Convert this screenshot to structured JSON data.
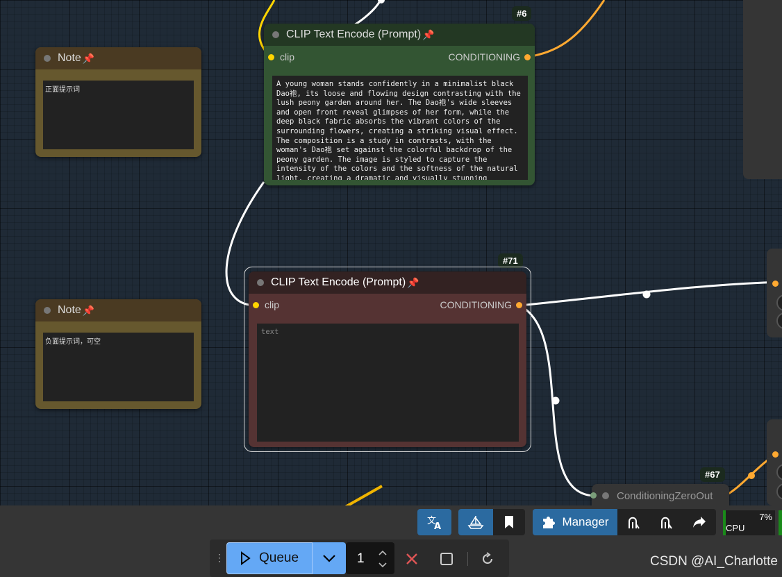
{
  "nodes": {
    "note1": {
      "title": "Note",
      "text": "正面提示词"
    },
    "note2": {
      "title": "Note",
      "text": "负面提示词，可空"
    },
    "clip6": {
      "badge": "#6",
      "title": "CLIP Text Encode (Prompt)",
      "input": "clip",
      "output": "CONDITIONING",
      "text": "A young woman stands confidently in a minimalist black Dao袍, its loose and flowing design contrasting with the lush peony garden around her. The Dao袍's wide sleeves and open front reveal glimpses of her form, while the deep black fabric absorbs the vibrant colors of the surrounding flowers, creating a striking visual effect. The composition is a study in contrasts, with the woman's Dao袍 set against the colorful backdrop of the peony garden. The image is styled to capture the intensity of the colors and the softness of the natural light, creating a dramatic and visually stunning"
    },
    "clip71": {
      "badge": "#71",
      "title": "CLIP Text Encode (Prompt)",
      "input": "clip",
      "output": "CONDITIONING",
      "placeholder": "text"
    },
    "zero67": {
      "badge": "#67",
      "title": "ConditioningZeroOut"
    }
  },
  "toolbar": {
    "manager_label": "Manager",
    "cpu_label": "CPU",
    "cpu_percent": "7%",
    "cpu_value": 0.07
  },
  "queue": {
    "label": "Queue",
    "count": "1"
  },
  "watermark": "CSDN @AI_Charlotte",
  "colors": {
    "accent_blue": "#2b6aa0",
    "queue_blue": "#64a8f5",
    "conditioning_wire": "#ffa931",
    "clip_wire": "#ffd500"
  }
}
